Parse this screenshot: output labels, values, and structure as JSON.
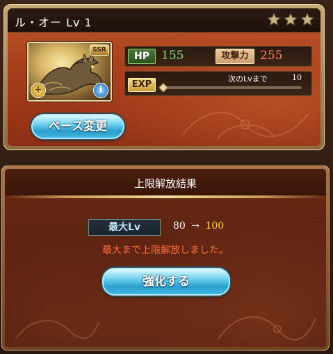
{
  "weapon": {
    "name": "ル・オー Lv 1",
    "stars": [
      "star-icon",
      "star-icon",
      "star-icon"
    ],
    "rarity_badge": "SSR",
    "plus_badge": "+",
    "info_badge": "i"
  },
  "stats": {
    "hp_label": "HP",
    "hp_value": "155",
    "atk_label": "攻撃力",
    "atk_value": "255",
    "exp_label": "EXP",
    "next_lv_text": "次のLvまで",
    "next_lv_value": "10",
    "exp_progress_fraction": 0.0
  },
  "buttons": {
    "base_change_label": "ベース変更",
    "enhance_label": "強化する"
  },
  "dialog": {
    "title": "上限解放結果",
    "max_lv_label": "最大Lv",
    "lv_old": "80",
    "lv_arrow": "→",
    "lv_new": "100",
    "message": "最大まで上限解放しました。"
  },
  "colors": {
    "hp_value": "#7fe07a",
    "atk_value": "#ff7f6a",
    "lv_new": "#ffd84a",
    "message": "#ff6a3a",
    "button_accent": "#2a9fcf"
  }
}
